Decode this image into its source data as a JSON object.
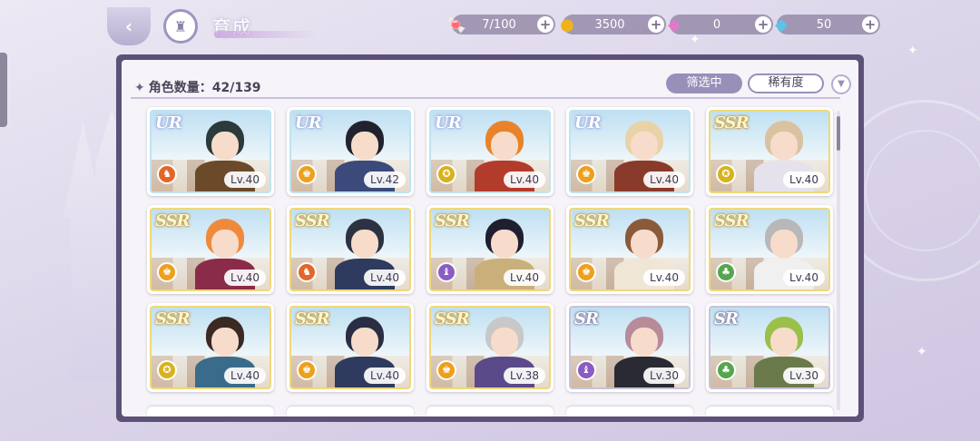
{
  "header": {
    "title": "育成"
  },
  "currencies": [
    {
      "name": "candy",
      "icon": "candy-icon",
      "value": "7/100"
    },
    {
      "name": "gold",
      "icon": "coin-icon",
      "value": "3500"
    },
    {
      "name": "pink-gem",
      "icon": "pink-diamond-icon",
      "value": "0"
    },
    {
      "name": "blue-gem",
      "icon": "blue-diamond-icon",
      "value": "50"
    }
  ],
  "panel": {
    "count_label": "角色数量：42/139",
    "filter_label": "筛选中",
    "sort_label": "稀有度"
  },
  "cards": [
    {
      "rarity": "UR",
      "level": "Lv.40",
      "attr": "red",
      "hair": "#2b3a3a",
      "body": "#6b4a2a"
    },
    {
      "rarity": "UR",
      "level": "Lv.42",
      "attr": "orange",
      "hair": "#22222e",
      "body": "#3b4a7a"
    },
    {
      "rarity": "UR",
      "level": "Lv.40",
      "attr": "yellow",
      "hair": "#e8832b",
      "body": "#b33b2b"
    },
    {
      "rarity": "UR",
      "level": "Lv.40",
      "attr": "orange",
      "hair": "#e8d3a8",
      "body": "#8a3a2a"
    },
    {
      "rarity": "SSR",
      "level": "Lv.40",
      "attr": "yellow",
      "hair": "#d9c2a0",
      "body": "#e6e2ec"
    },
    {
      "rarity": "SSR",
      "level": "Lv.40",
      "attr": "orange",
      "hair": "#ef8a3d",
      "body": "#8b2b4a"
    },
    {
      "rarity": "SSR",
      "level": "Lv.40",
      "attr": "red",
      "hair": "#2d3242",
      "body": "#2e3a5e"
    },
    {
      "rarity": "SSR",
      "level": "Lv.40",
      "attr": "purple",
      "hair": "#1f1f30",
      "body": "#c9b07a"
    },
    {
      "rarity": "SSR",
      "level": "Lv.40",
      "attr": "orange",
      "hair": "#8b5a3a",
      "body": "#efe6d6"
    },
    {
      "rarity": "SSR",
      "level": "Lv.40",
      "attr": "green",
      "hair": "#b8b8b8",
      "body": "#f0f0f0"
    },
    {
      "rarity": "SSR",
      "level": "Lv.40",
      "attr": "yellow",
      "hair": "#3a2a22",
      "body": "#3a6b8a"
    },
    {
      "rarity": "SSR",
      "level": "Lv.40",
      "attr": "orange",
      "hair": "#2a2e44",
      "body": "#2e3b5e"
    },
    {
      "rarity": "SSR",
      "level": "Lv.38",
      "attr": "orange",
      "hair": "#c8c8c8",
      "body": "#5b4a8a"
    },
    {
      "rarity": "SR",
      "level": "Lv.30",
      "attr": "purple",
      "hair": "#b88a9a",
      "body": "#2a2a34"
    },
    {
      "rarity": "SR",
      "level": "Lv.30",
      "attr": "green",
      "hair": "#9ac04a",
      "body": "#6b7a4a"
    }
  ],
  "colors": {
    "panel_frame": "#5d5178",
    "filter_active": "#9a8fb8",
    "ur_border": "#bfe3f2",
    "ssr_border": "#f1d77a",
    "sr_border": "#c7c3da"
  }
}
